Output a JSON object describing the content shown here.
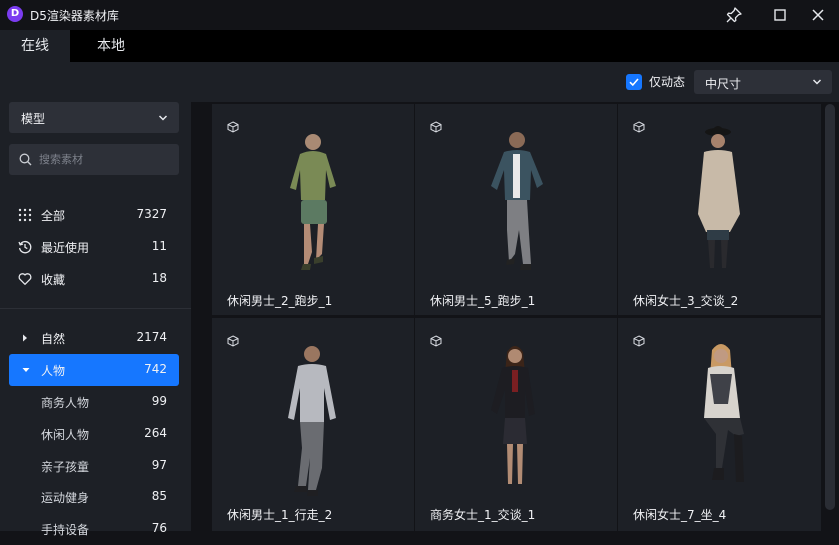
{
  "app": {
    "logo_letter": "D",
    "title": "D5渲染器素材库"
  },
  "tabs": [
    {
      "label": "在线",
      "active": true
    },
    {
      "label": "本地",
      "active": false
    }
  ],
  "toolbar": {
    "dynamic_only": {
      "label": "仅动态",
      "checked": true
    },
    "size_select": {
      "value": "中尺寸"
    }
  },
  "sidebar": {
    "type_select": {
      "value": "模型"
    },
    "search": {
      "placeholder": "搜索素材"
    },
    "quick_items": [
      {
        "label": "全部",
        "count": "7327",
        "icon": "grid-icon"
      },
      {
        "label": "最近使用",
        "count": "11",
        "icon": "history-icon"
      },
      {
        "label": "收藏",
        "count": "18",
        "icon": "heart-icon"
      }
    ],
    "categories": [
      {
        "label": "自然",
        "count": "2174",
        "expanded": false
      },
      {
        "label": "人物",
        "count": "742",
        "expanded": true,
        "active": true
      }
    ],
    "subcategories": [
      {
        "label": "商务人物",
        "count": "99"
      },
      {
        "label": "休闲人物",
        "count": "264"
      },
      {
        "label": "亲子孩童",
        "count": "97"
      },
      {
        "label": "运动健身",
        "count": "85"
      },
      {
        "label": "手持设备",
        "count": "76"
      }
    ]
  },
  "assets": [
    {
      "name": "休闲男士_2_跑步_1",
      "icon": "model-cube-icon"
    },
    {
      "name": "休闲男士_5_跑步_1",
      "icon": "model-cube-icon"
    },
    {
      "name": "休闲女士_3_交谈_2",
      "icon": "model-cube-icon"
    },
    {
      "name": "休闲男士_1_行走_2",
      "icon": "model-cube-icon"
    },
    {
      "name": "商务女士_1_交谈_1",
      "icon": "model-cube-icon"
    },
    {
      "name": "休闲女士_7_坐_4",
      "icon": "model-cube-icon"
    }
  ],
  "colors": {
    "accent": "#1677ff",
    "panel": "#1d2026",
    "background": "#121317"
  }
}
